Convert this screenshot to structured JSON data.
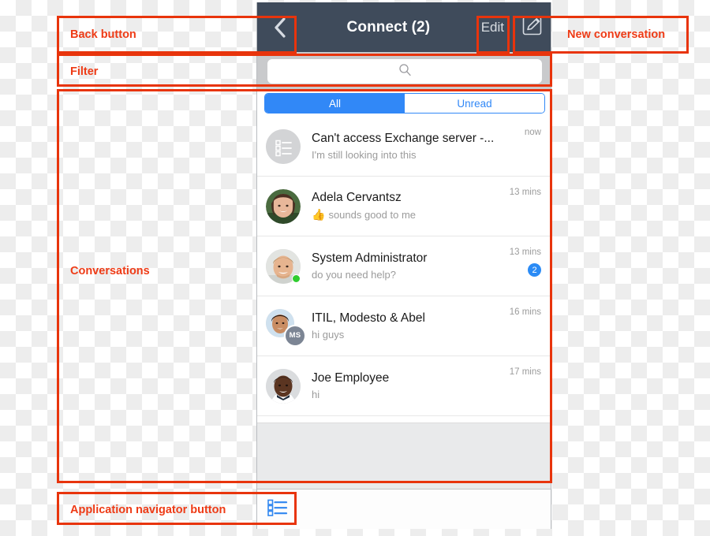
{
  "header": {
    "title": "Connect (2)",
    "back_icon": "chevron-left-icon",
    "edit_label": "Edit",
    "compose_icon": "compose-pencil-square-icon"
  },
  "filter": {
    "value": "",
    "placeholder": "",
    "search_icon": "search-icon"
  },
  "tabs": [
    {
      "label": "All",
      "selected": true
    },
    {
      "label": "Unread",
      "selected": false
    }
  ],
  "conversations": [
    {
      "name": "Can't access Exchange server -...",
      "snippet": "I'm still looking into this",
      "time": "now",
      "avatar_type": "task-list-icon",
      "online": false,
      "badge": "",
      "reaction": "",
      "group_initials": ""
    },
    {
      "name": "Adela Cervantsz",
      "snippet": "sounds good to me",
      "time": "13 mins",
      "avatar_type": "photo-woman",
      "online": false,
      "badge": "",
      "reaction": "👍",
      "group_initials": ""
    },
    {
      "name": "System Administrator",
      "snippet": "do you need help?",
      "time": "13 mins",
      "avatar_type": "photo-man-blond",
      "online": true,
      "badge": "2",
      "reaction": "",
      "group_initials": ""
    },
    {
      "name": "ITIL, Modesto & Abel",
      "snippet": "hi guys",
      "time": "16 mins",
      "avatar_type": "photo-man-curly",
      "online": false,
      "badge": "",
      "reaction": "",
      "group_initials": "MS"
    },
    {
      "name": "Joe Employee",
      "snippet": "hi",
      "time": "17 mins",
      "avatar_type": "photo-man-dark",
      "online": false,
      "badge": "",
      "reaction": "",
      "group_initials": ""
    }
  ],
  "bottom_bar": {
    "app_navigator_icon": "application-navigator-list-icon"
  },
  "annotations": [
    {
      "label": "Back button"
    },
    {
      "label": "Filter"
    },
    {
      "label": "Conversations"
    },
    {
      "label": "Application navigator button"
    },
    {
      "label": "Edit"
    },
    {
      "label": "New conversation"
    }
  ],
  "colors": {
    "nav_background": "#3f4b5b",
    "accent_blue": "#3188f7",
    "badge_blue": "#2b8bf5",
    "annotation_red": "#e8340c",
    "online_green": "#2fcc2f"
  }
}
